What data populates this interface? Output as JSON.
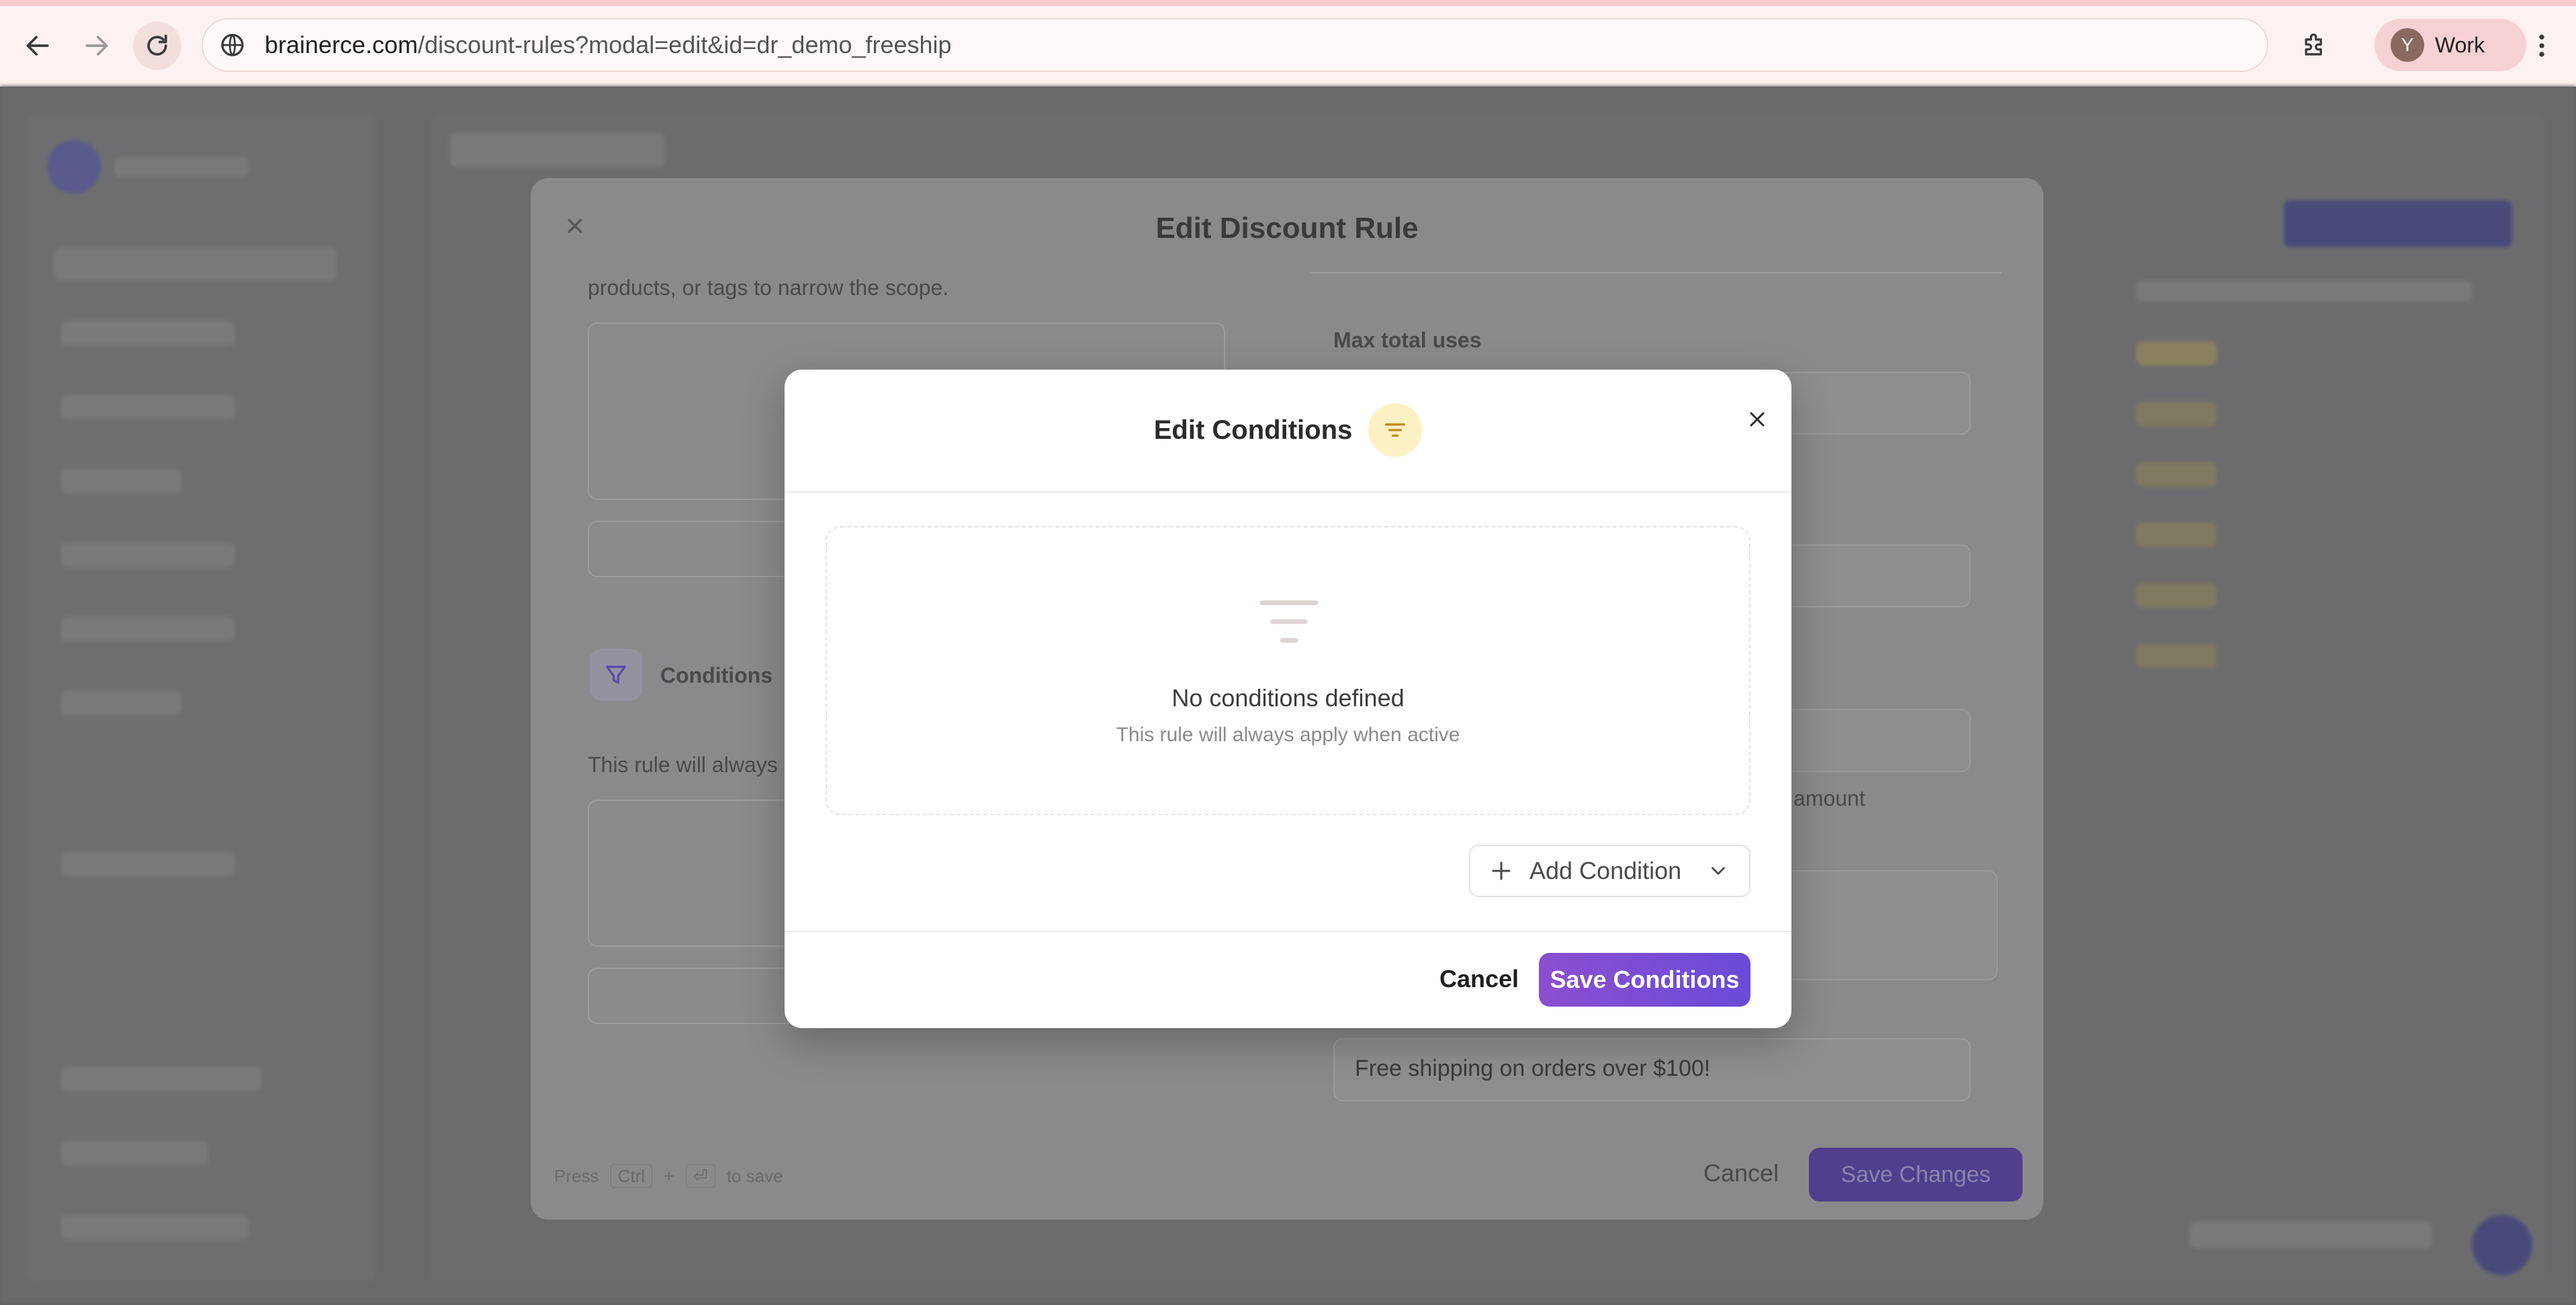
{
  "browser": {
    "url_host": "brainerce.com",
    "url_path": "/discount-rules?modal=edit&id=dr_demo_freeship",
    "profile_initial": "Y",
    "profile_name": "Work"
  },
  "outer_modal": {
    "title": "Edit Discount Rule",
    "scope_help_text": "products, or tags to narrow the scope.",
    "max_total_uses_label": "Max total uses",
    "conditions_label": "Conditions",
    "conditions_help_text": "This rule will always ap",
    "amount_help_text": "amount",
    "description_value": "Free shipping on orders over $100!",
    "shortcut_hint": "Press",
    "shortcut_key_1": "Ctrl",
    "shortcut_plus": "+",
    "shortcut_key_2": "⏎",
    "shortcut_suffix": "to save",
    "cancel_label": "Cancel",
    "save_label": "Save Changes"
  },
  "dialog": {
    "title": "Edit Conditions",
    "empty_title": "No conditions defined",
    "empty_subtitle": "This rule will always apply when active",
    "add_condition_label": "Add Condition",
    "cancel_label": "Cancel",
    "save_label": "Save Conditions"
  },
  "colors": {
    "accent_start": "#8a4fcf",
    "accent_end": "#6a4bd8",
    "title_icon_bg": "#fdf0c4",
    "title_icon_fg": "#c58a1a"
  },
  "icons": {
    "back": "arrow-left-icon",
    "forward": "arrow-right-icon",
    "reload": "reload-icon",
    "site_info": "site-info-icon",
    "extensions": "puzzle-icon",
    "menu": "kebab-menu-icon",
    "title_filter": "filter-lines-icon",
    "close": "close-icon",
    "empty_state": "filter-lines-icon",
    "add": "plus-icon",
    "dropdown": "chevron-down-icon"
  }
}
